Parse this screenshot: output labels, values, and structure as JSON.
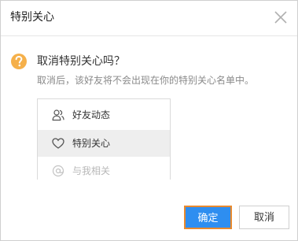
{
  "dialog": {
    "title": "特别关心",
    "question": "取消特别关心吗？",
    "description": "取消后，该好友将不会出现在你的特别关心名单中。",
    "list": [
      {
        "label": "好友动态",
        "icon": "friends-icon"
      },
      {
        "label": "特别关心",
        "icon": "heart-icon",
        "selected": true
      },
      {
        "label": "与我相关",
        "icon": "at-icon"
      }
    ],
    "confirm_label": "确定",
    "cancel_label": "取消"
  },
  "colors": {
    "primary": "#2e8ef0",
    "focus_border": "#e98a2e",
    "question_icon": "#f5b04a",
    "selected_bg": "#eeeeee"
  }
}
